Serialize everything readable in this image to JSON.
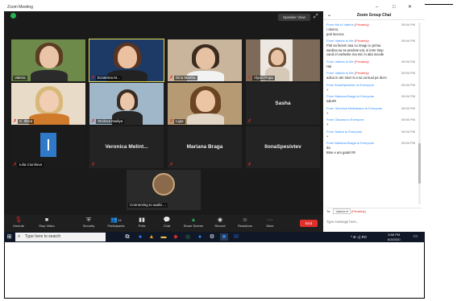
{
  "window": {
    "title": "Zoom Meeting",
    "controls": [
      "–",
      "□",
      "✕"
    ]
  },
  "header": {
    "speaker_view_label": "Speaker View"
  },
  "participants": [
    {
      "name": "Valeria"
    },
    {
      "name": "Ecaterina M..."
    },
    {
      "name": "Dina Martha"
    },
    {
      "name": "Alyazi Popa"
    },
    {
      "name": "C. Ilinca"
    },
    {
      "name": "Stoilova Nadiya"
    },
    {
      "name": "Ligia"
    },
    {
      "name": "Sasha"
    },
    {
      "name": "Iulia Cionilova"
    },
    {
      "name": "Veronica  Melint..."
    },
    {
      "name": "Mariana Braga"
    },
    {
      "name": "IlonaSpesivtev"
    },
    {
      "name": "Connecting to audio ..."
    }
  ],
  "toolbar": {
    "unmute": "Unmute",
    "stop_video": "Stop Video",
    "security": "Security",
    "participants": "Participants",
    "participants_count": "14",
    "polls": "Polls",
    "chat": "Chat",
    "share_screen": "Share Screen",
    "record": "Record",
    "reactions": "Reactions",
    "more": "More",
    "end": "End"
  },
  "chat": {
    "title": "Zoom Group Chat",
    "messages": [
      {
        "from": "From Me to Valeria",
        "privacy": "(Privately)",
        "time": "05:56 PM",
        "text": "I dunno,\npoti incerca"
      },
      {
        "from": "From Valeria to Me",
        "privacy": "(Privately)",
        "time": "05:56 PM",
        "text": "Poti sa facem asa cu imagi cu prima\nsardina sa se predeie toti, si intre timp\ncand el vorbeste ma mic in alta incede"
      },
      {
        "from": "From Valeria to Me",
        "privacy": "(Privately)",
        "time": "05:56 PM",
        "text": "Hai"
      },
      {
        "from": "From Valeria to Me",
        "privacy": "(Privately)",
        "time": "05:56 PM",
        "text": "adica in am ruter si a sa va kuul pe dicm"
      },
      {
        "from": "From IlonaSpesivtev to Everyone",
        "privacy": "",
        "time": "05:56 PM",
        "text": "+"
      },
      {
        "from": "From Mariana Braga to Everyone",
        "privacy": "",
        "time": "05:56 PM",
        "text": "salut!!!"
      },
      {
        "from": "From Veronica Melinteanu to Everyone",
        "privacy": "",
        "time": "05:56 PM",
        "text": "+"
      },
      {
        "from": "From Oksana to Everyone",
        "privacy": "",
        "time": "05:56 PM",
        "text": "+"
      },
      {
        "from": "From Sasha to Everyone",
        "privacy": "",
        "time": "05:56 PM",
        "text": "+"
      },
      {
        "from": "From Mariana Braga to Everyone",
        "privacy": "",
        "time": "05:56 PM",
        "text": "da\nBine e am gata!!!!!!!"
      }
    ],
    "to_label": "To:",
    "to_value": "Valeria ▾",
    "to_privacy": "(Privately)",
    "input_placeholder": "Type message here..."
  },
  "taskbar": {
    "search_placeholder": "Type here to search",
    "tray_text": "^  ⊞  ◁)  RO",
    "time": "5:56 PM",
    "date": "6/3/2020"
  },
  "colors": {
    "accent": "#2d8cff",
    "private": "#e02828",
    "end": "#e0302c",
    "share": "#25b14f"
  }
}
